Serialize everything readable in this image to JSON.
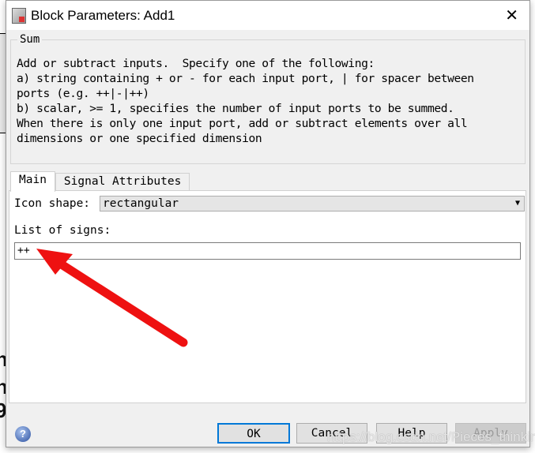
{
  "window": {
    "title": "Block Parameters: Add1",
    "close_icon": "close-icon"
  },
  "group": {
    "label": "Sum",
    "description": "Add or subtract inputs.  Specify one of the following:\na) string containing + or - for each input port, | for spacer between\nports (e.g. ++|-|++)\nb) scalar, >= 1, specifies the number of input ports to be summed.\nWhen there is only one input port, add or subtract elements over all\ndimensions or one specified dimension"
  },
  "tabs": [
    {
      "label": "Main",
      "active": true
    },
    {
      "label": "Signal Attributes",
      "active": false
    }
  ],
  "main": {
    "icon_shape_label": "Icon shape:",
    "icon_shape_value": "rectangular",
    "signs_label": "List of signs:",
    "signs_value": "++"
  },
  "buttons": {
    "ok": "OK",
    "cancel": "Cancel",
    "help": "Help",
    "apply": "Apply"
  },
  "help_icon": "?",
  "annotation": {
    "color": "#ee1111"
  },
  "watermark": "https://blog.csdn.net/Pieces_thinking"
}
